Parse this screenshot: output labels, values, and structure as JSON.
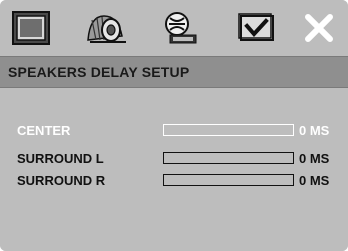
{
  "header": {
    "title": "SPEAKERS DELAY SETUP"
  },
  "tabs": [
    {
      "name": "general-setup",
      "icon": "tv-screen-icon"
    },
    {
      "name": "audio-setup",
      "icon": "speaker-icon",
      "active": true
    },
    {
      "name": "dolby-setup",
      "icon": "dolby-icon"
    },
    {
      "name": "preference-setup",
      "icon": "checkmark-screen-icon"
    },
    {
      "name": "exit",
      "icon": "close-icon"
    }
  ],
  "speakers": [
    {
      "label": "CENTER",
      "value": "0 MS",
      "selected": true
    },
    {
      "label": "SURROUND L",
      "value": "0 MS",
      "selected": false
    },
    {
      "label": "SURROUND R",
      "value": "0 MS",
      "selected": false
    }
  ],
  "colors": {
    "background": "#bdbdbd",
    "header": "#8f8f8f",
    "selected_text": "#ffffff",
    "normal_text": "#111111"
  }
}
